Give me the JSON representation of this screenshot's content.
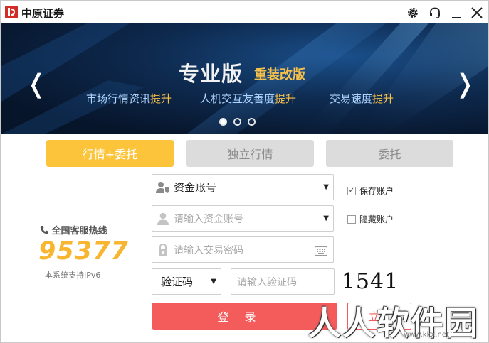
{
  "window": {
    "title": "中原证券"
  },
  "titlebar": {
    "icons": [
      "settings-icon",
      "headset-icon",
      "minimize-icon",
      "close-icon"
    ],
    "minimize_glyph": "_",
    "close_glyph": "✕"
  },
  "banner": {
    "main_title": "专业版",
    "sub_title": "重装改版",
    "features": [
      {
        "text": "市场行情资讯",
        "highlight": "提升"
      },
      {
        "text": "人机交互友善度",
        "highlight": "提升"
      },
      {
        "text": "交易速度",
        "highlight": "提升"
      }
    ],
    "prev_arrow": "❬",
    "next_arrow": "❭",
    "slide_count": 3,
    "active_slide": 1
  },
  "tabs": [
    {
      "label": "行情+委托",
      "active": true
    },
    {
      "label": "独立行情",
      "active": false
    },
    {
      "label": "委托",
      "active": false
    }
  ],
  "hotline": {
    "label": "全国客服热线",
    "number": "95377",
    "ipv6_note": "本系统支持IPv6"
  },
  "form": {
    "account_type": {
      "value": "资金账号"
    },
    "account": {
      "placeholder": "请输入资金账号"
    },
    "password": {
      "placeholder": "请输入交易密码"
    },
    "verify_type": {
      "value": "验证码"
    },
    "verify_code": {
      "placeholder": "请输入验证码"
    },
    "captcha_text": "1541",
    "save_account": {
      "label": "保存账户",
      "checked": true
    },
    "hide_account": {
      "label": "隐藏账户",
      "checked": false
    },
    "login_label": "登录",
    "register_label": "立即"
  },
  "watermark": {
    "text": "人人软件园",
    "url": "www.kkx.net"
  },
  "colors": {
    "accent_yellow": "#fcc43a",
    "login_red": "#f45b5b",
    "hotline_orange": "#f8b630",
    "banner_highlight": "#f6c04a"
  }
}
